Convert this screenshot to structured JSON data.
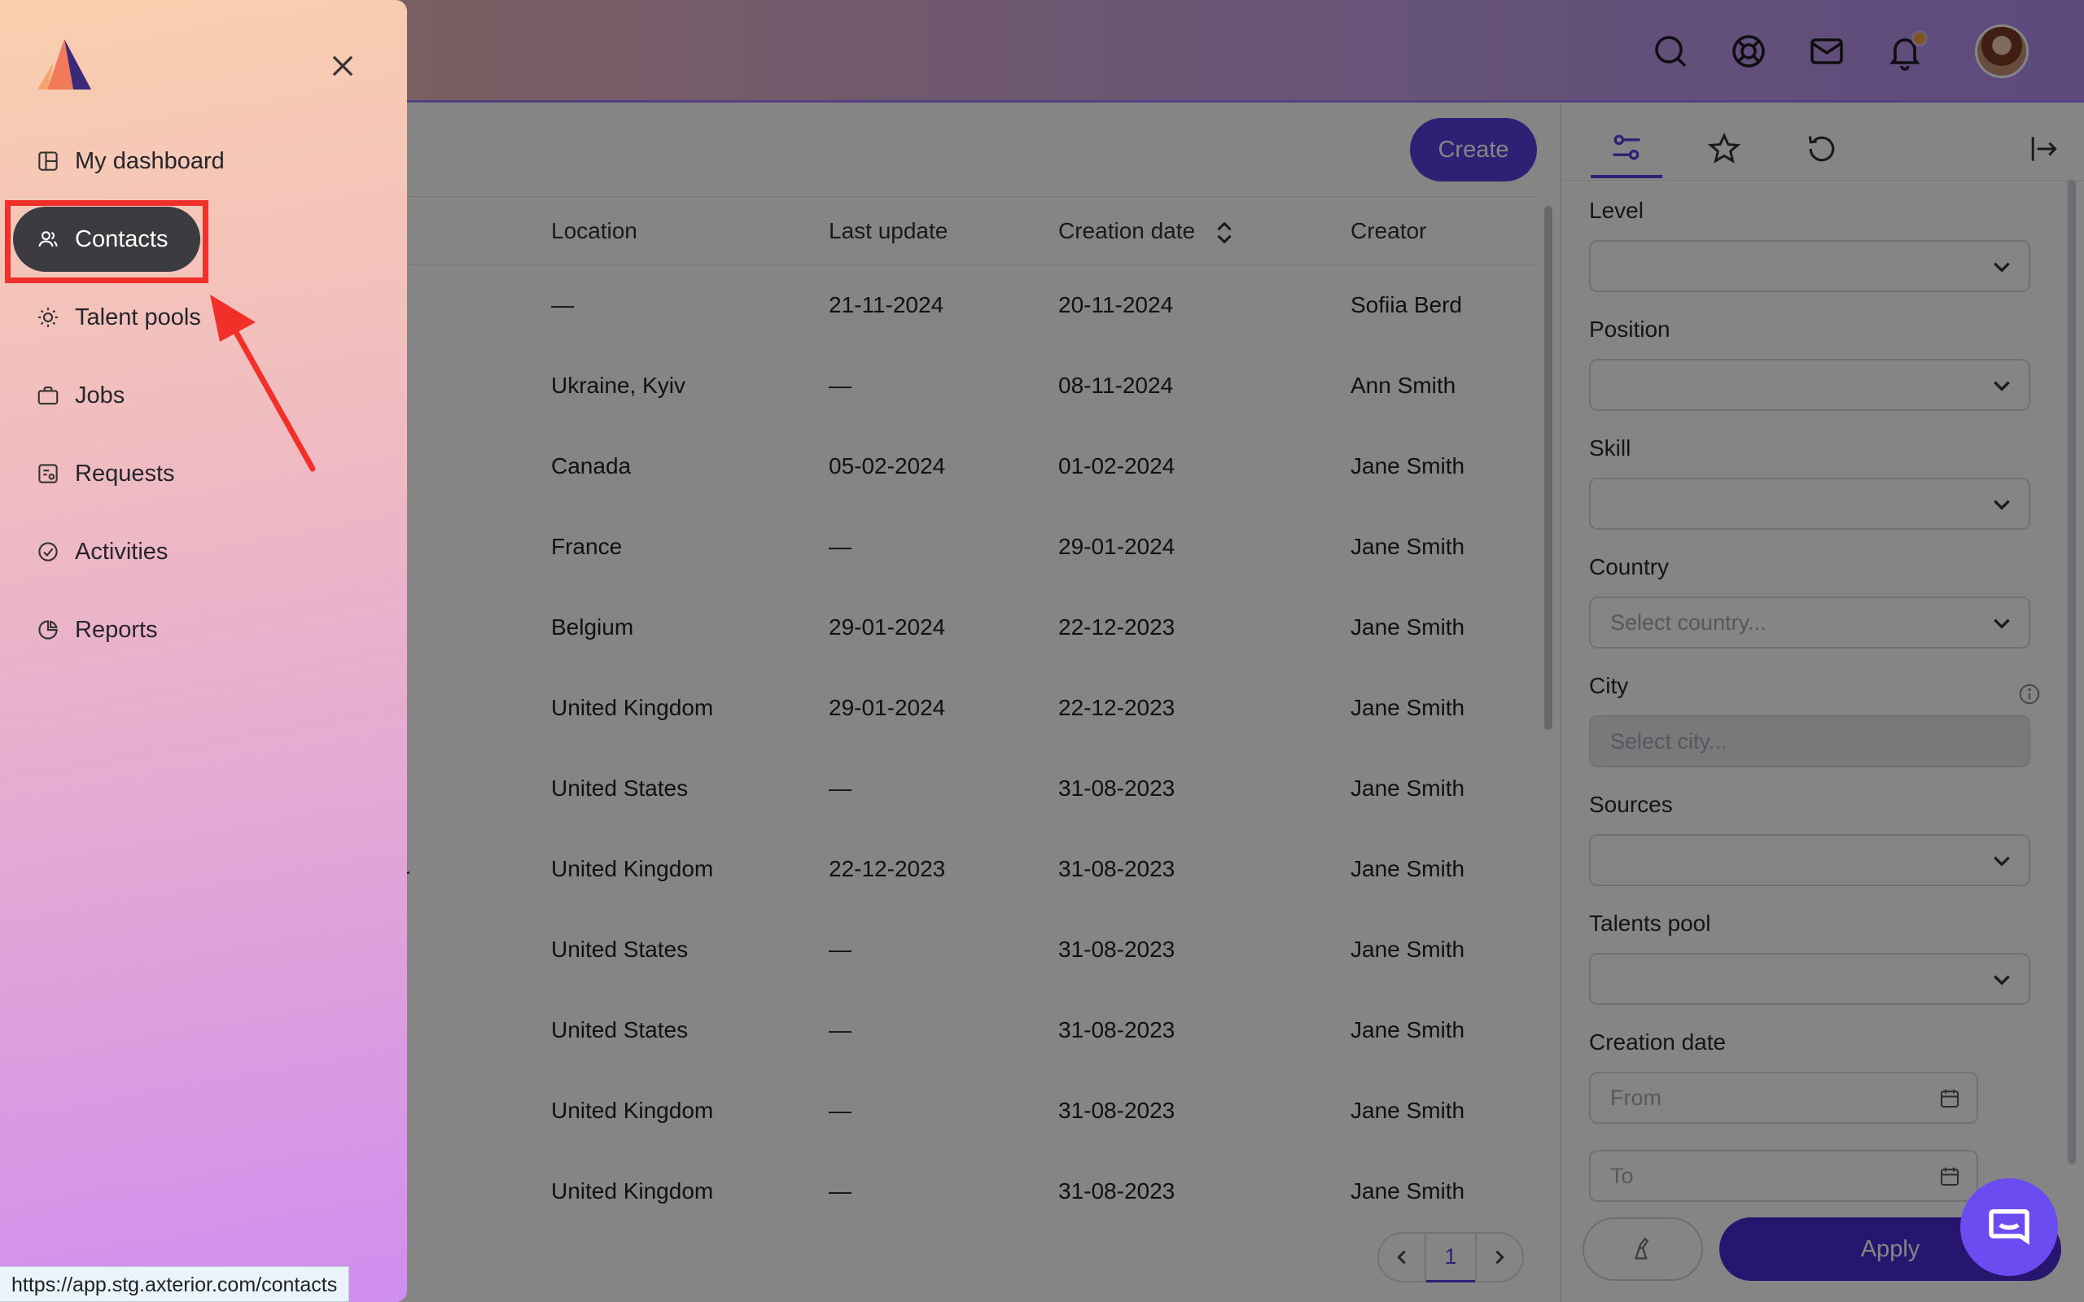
{
  "header": {
    "icons": [
      "search-icon",
      "support-icon",
      "mail-icon",
      "bell-icon"
    ],
    "notification_color": "#f2a33a"
  },
  "toolbar": {
    "create_label": "Create"
  },
  "table": {
    "columns": [
      "Location",
      "Last update",
      "Creation date",
      "Creator"
    ],
    "rows": [
      {
        "location": "—",
        "last_update": "21-11-2024",
        "creation_date": "20-11-2024",
        "creator": "Sofiia Berd"
      },
      {
        "location": "Ukraine, Kyiv",
        "last_update": "—",
        "creation_date": "08-11-2024",
        "creator": "Ann Smith"
      },
      {
        "location": "Canada",
        "last_update": "05-02-2024",
        "creation_date": "01-02-2024",
        "creator": "Jane Smith"
      },
      {
        "location": "France",
        "last_update": "—",
        "creation_date": "29-01-2024",
        "creator": "Jane Smith"
      },
      {
        "location": "Belgium",
        "last_update": "29-01-2024",
        "creation_date": "22-12-2023",
        "creator": "Jane Smith"
      },
      {
        "location": "United Kingdom",
        "last_update": "29-01-2024",
        "creation_date": "22-12-2023",
        "creator": "Jane Smith"
      },
      {
        "location": "United States",
        "last_update": "—",
        "creation_date": "31-08-2023",
        "creator": "Jane Smith"
      },
      {
        "location": "United Kingdom",
        "last_update": "22-12-2023",
        "creation_date": "31-08-2023",
        "creator": "Jane Smith"
      },
      {
        "location": "United States",
        "last_update": "—",
        "creation_date": "31-08-2023",
        "creator": "Jane Smith"
      },
      {
        "location": "United States",
        "last_update": "—",
        "creation_date": "31-08-2023",
        "creator": "Jane Smith"
      },
      {
        "location": "United Kingdom",
        "last_update": "—",
        "creation_date": "31-08-2023",
        "creator": "Jane Smith"
      },
      {
        "location": "United Kingdom",
        "last_update": "—",
        "creation_date": "31-08-2023",
        "creator": "Jane Smith"
      }
    ],
    "stray_text": "r"
  },
  "pagination": {
    "current_page": "1"
  },
  "filters": {
    "tabs": [
      "filters-icon",
      "star-icon",
      "history-icon"
    ],
    "collapse_icon": "collapse-panel-icon",
    "level_label": "Level",
    "position_label": "Position",
    "skill_label": "Skill",
    "country_label": "Country",
    "country_placeholder": "Select country...",
    "city_label": "City",
    "city_placeholder": "Select city...",
    "sources_label": "Sources",
    "talents_pool_label": "Talents pool",
    "creation_date_label": "Creation date",
    "from_placeholder": "From",
    "to_placeholder": "To",
    "apply_label": "Apply"
  },
  "sidebar": {
    "items": [
      {
        "label": "My dashboard",
        "icon": "dashboard-icon"
      },
      {
        "label": "Contacts",
        "icon": "contacts-icon",
        "active": true
      },
      {
        "label": "Talent pools",
        "icon": "talent-pools-icon"
      },
      {
        "label": "Jobs",
        "icon": "briefcase-icon"
      },
      {
        "label": "Requests",
        "icon": "requests-icon"
      },
      {
        "label": "Activities",
        "icon": "activities-icon"
      },
      {
        "label": "Reports",
        "icon": "reports-icon"
      }
    ]
  },
  "status_bar": {
    "url": "https://app.stg.axterior.com/contacts"
  },
  "colors": {
    "accent": "#5b3fe0",
    "highlight": "#f2302a",
    "active_nav": "#3b3b40"
  }
}
